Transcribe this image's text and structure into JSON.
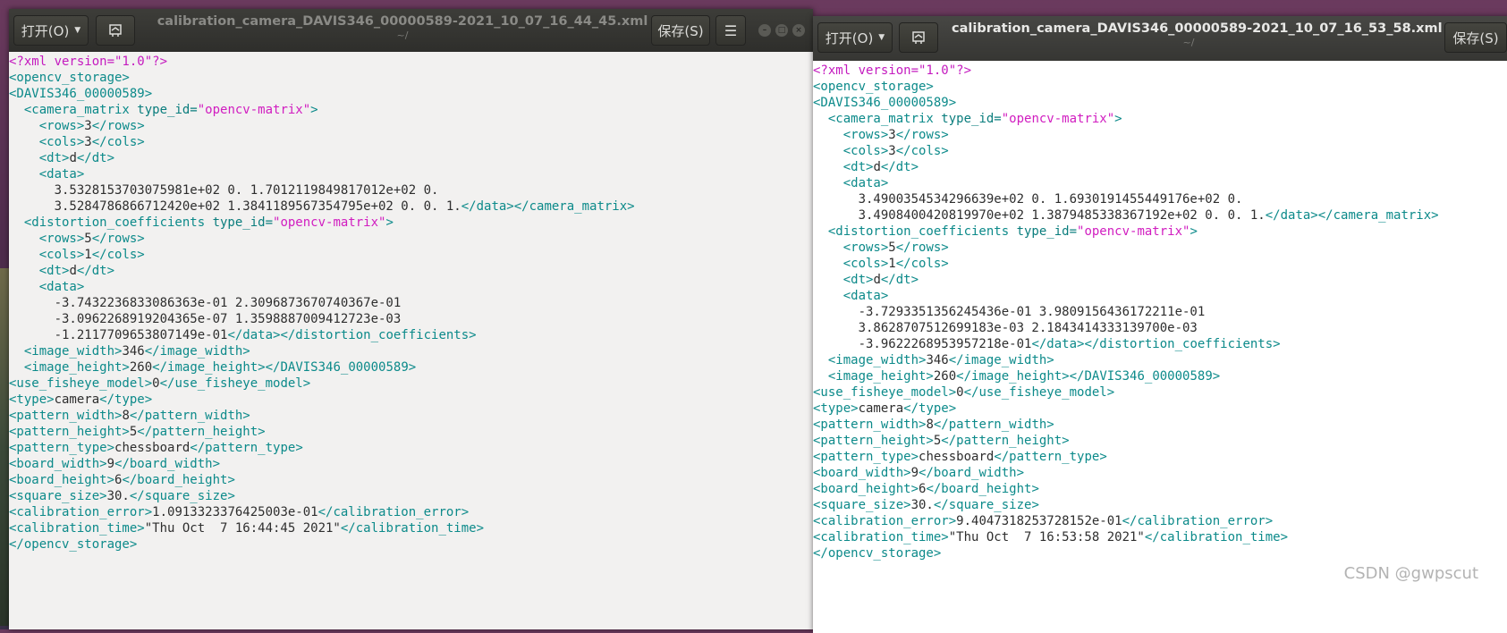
{
  "window1": {
    "title": "calibration_camera_DAVIS346_00000589-2021_10_07_16_44_45.xml",
    "subtitle": "~/",
    "open_label": "打开(O)",
    "save_label": "保存(S)",
    "minimize_symbol": "–",
    "maximize_symbol": "□",
    "close_symbol": "×",
    "menu_icon": "☰",
    "editor_lines": [
      [
        [
          "pi",
          "<?xml version=\"1.0\"?>"
        ]
      ],
      [
        [
          "tag",
          "<opencv_storage>"
        ]
      ],
      [
        [
          "tag",
          "<DAVIS346_00000589>"
        ]
      ],
      [
        [
          "txt",
          "  "
        ],
        [
          "tag",
          "<camera_matrix "
        ],
        [
          "attr",
          "type_id="
        ],
        [
          "str",
          "\"opencv-matrix\""
        ],
        [
          "tag",
          ">"
        ]
      ],
      [
        [
          "txt",
          "    "
        ],
        [
          "tag",
          "<rows>"
        ],
        [
          "txt",
          "3"
        ],
        [
          "tag",
          "</rows>"
        ]
      ],
      [
        [
          "txt",
          "    "
        ],
        [
          "tag",
          "<cols>"
        ],
        [
          "txt",
          "3"
        ],
        [
          "tag",
          "</cols>"
        ]
      ],
      [
        [
          "txt",
          "    "
        ],
        [
          "tag",
          "<dt>"
        ],
        [
          "txt",
          "d"
        ],
        [
          "tag",
          "</dt>"
        ]
      ],
      [
        [
          "txt",
          "    "
        ],
        [
          "tag",
          "<data>"
        ]
      ],
      [
        [
          "txt",
          "      3.5328153703075981e+02 0. 1.7012119849817012e+02 0."
        ]
      ],
      [
        [
          "txt",
          "      3.5284786866712420e+02 1.3841189567354795e+02 0. 0. 1."
        ],
        [
          "tag",
          "</data></camera_matrix>"
        ]
      ],
      [
        [
          "txt",
          "  "
        ],
        [
          "tag",
          "<distortion_coefficients "
        ],
        [
          "attr",
          "type_id="
        ],
        [
          "str",
          "\"opencv-matrix\""
        ],
        [
          "tag",
          ">"
        ]
      ],
      [
        [
          "txt",
          "    "
        ],
        [
          "tag",
          "<rows>"
        ],
        [
          "txt",
          "5"
        ],
        [
          "tag",
          "</rows>"
        ]
      ],
      [
        [
          "txt",
          "    "
        ],
        [
          "tag",
          "<cols>"
        ],
        [
          "txt",
          "1"
        ],
        [
          "tag",
          "</cols>"
        ]
      ],
      [
        [
          "txt",
          "    "
        ],
        [
          "tag",
          "<dt>"
        ],
        [
          "txt",
          "d"
        ],
        [
          "tag",
          "</dt>"
        ]
      ],
      [
        [
          "txt",
          "    "
        ],
        [
          "tag",
          "<data>"
        ]
      ],
      [
        [
          "txt",
          "      -3.7432236833086363e-01 2.3096873670740367e-01"
        ]
      ],
      [
        [
          "txt",
          "      -3.0962268919204365e-07 1.3598887009412723e-03"
        ]
      ],
      [
        [
          "txt",
          "      -1.2117709653807149e-01"
        ],
        [
          "tag",
          "</data></distortion_coefficients>"
        ]
      ],
      [
        [
          "txt",
          "  "
        ],
        [
          "tag",
          "<image_width>"
        ],
        [
          "txt",
          "346"
        ],
        [
          "tag",
          "</image_width>"
        ]
      ],
      [
        [
          "txt",
          "  "
        ],
        [
          "tag",
          "<image_height>"
        ],
        [
          "txt",
          "260"
        ],
        [
          "tag",
          "</image_height></DAVIS346_00000589>"
        ]
      ],
      [
        [
          "tag",
          "<use_fisheye_model>"
        ],
        [
          "txt",
          "0"
        ],
        [
          "tag",
          "</use_fisheye_model>"
        ]
      ],
      [
        [
          "tag",
          "<type>"
        ],
        [
          "txt",
          "camera"
        ],
        [
          "tag",
          "</type>"
        ]
      ],
      [
        [
          "tag",
          "<pattern_width>"
        ],
        [
          "txt",
          "8"
        ],
        [
          "tag",
          "</pattern_width>"
        ]
      ],
      [
        [
          "tag",
          "<pattern_height>"
        ],
        [
          "txt",
          "5"
        ],
        [
          "tag",
          "</pattern_height>"
        ]
      ],
      [
        [
          "tag",
          "<pattern_type>"
        ],
        [
          "txt",
          "chessboard"
        ],
        [
          "tag",
          "</pattern_type>"
        ]
      ],
      [
        [
          "tag",
          "<board_width>"
        ],
        [
          "txt",
          "9"
        ],
        [
          "tag",
          "</board_width>"
        ]
      ],
      [
        [
          "tag",
          "<board_height>"
        ],
        [
          "txt",
          "6"
        ],
        [
          "tag",
          "</board_height>"
        ]
      ],
      [
        [
          "tag",
          "<square_size>"
        ],
        [
          "txt",
          "30."
        ],
        [
          "tag",
          "</square_size>"
        ]
      ],
      [
        [
          "tag",
          "<calibration_error>"
        ],
        [
          "txt",
          "1.0913323376425003e-01"
        ],
        [
          "tag",
          "</calibration_error>"
        ]
      ],
      [
        [
          "tag",
          "<calibration_time>"
        ],
        [
          "txt",
          "\"Thu Oct  7 16:44:45 2021\""
        ],
        [
          "tag",
          "</calibration_time>"
        ]
      ],
      [
        [
          "tag",
          "</opencv_storage>"
        ]
      ]
    ]
  },
  "window2": {
    "title": "calibration_camera_DAVIS346_00000589-2021_10_07_16_53_58.xml",
    "subtitle": "~/",
    "open_label": "打开(O)",
    "save_label": "保存(S)",
    "editor_lines": [
      [
        [
          "pi",
          "<?xml version=\"1.0\"?>"
        ]
      ],
      [
        [
          "tag",
          "<opencv_storage>"
        ]
      ],
      [
        [
          "tag",
          "<DAVIS346_00000589>"
        ]
      ],
      [
        [
          "txt",
          "  "
        ],
        [
          "tag",
          "<camera_matrix "
        ],
        [
          "attr",
          "type_id="
        ],
        [
          "str",
          "\"opencv-matrix\""
        ],
        [
          "tag",
          ">"
        ]
      ],
      [
        [
          "txt",
          "    "
        ],
        [
          "tag",
          "<rows>"
        ],
        [
          "txt",
          "3"
        ],
        [
          "tag",
          "</rows>"
        ]
      ],
      [
        [
          "txt",
          "    "
        ],
        [
          "tag",
          "<cols>"
        ],
        [
          "txt",
          "3"
        ],
        [
          "tag",
          "</cols>"
        ]
      ],
      [
        [
          "txt",
          "    "
        ],
        [
          "tag",
          "<dt>"
        ],
        [
          "txt",
          "d"
        ],
        [
          "tag",
          "</dt>"
        ]
      ],
      [
        [
          "txt",
          "    "
        ],
        [
          "tag",
          "<data>"
        ]
      ],
      [
        [
          "txt",
          "      3.4900354534296639e+02 0. 1.6930191455449176e+02 0."
        ]
      ],
      [
        [
          "txt",
          "      3.4908400420819970e+02 1.3879485338367192e+02 0. 0. 1."
        ],
        [
          "tag",
          "</data></camera_matrix>"
        ]
      ],
      [
        [
          "txt",
          "  "
        ],
        [
          "tag",
          "<distortion_coefficients "
        ],
        [
          "attr",
          "type_id="
        ],
        [
          "str",
          "\"opencv-matrix\""
        ],
        [
          "tag",
          ">"
        ]
      ],
      [
        [
          "txt",
          "    "
        ],
        [
          "tag",
          "<rows>"
        ],
        [
          "txt",
          "5"
        ],
        [
          "tag",
          "</rows>"
        ]
      ],
      [
        [
          "txt",
          "    "
        ],
        [
          "tag",
          "<cols>"
        ],
        [
          "txt",
          "1"
        ],
        [
          "tag",
          "</cols>"
        ]
      ],
      [
        [
          "txt",
          "    "
        ],
        [
          "tag",
          "<dt>"
        ],
        [
          "txt",
          "d"
        ],
        [
          "tag",
          "</dt>"
        ]
      ],
      [
        [
          "txt",
          "    "
        ],
        [
          "tag",
          "<data>"
        ]
      ],
      [
        [
          "txt",
          "      -3.7293351356245436e-01 3.9809156436172211e-01"
        ]
      ],
      [
        [
          "txt",
          "      3.8628707512699183e-03 2.1843414333139700e-03"
        ]
      ],
      [
        [
          "txt",
          "      -3.9622268953957218e-01"
        ],
        [
          "tag",
          "</data></distortion_coefficients>"
        ]
      ],
      [
        [
          "txt",
          "  "
        ],
        [
          "tag",
          "<image_width>"
        ],
        [
          "txt",
          "346"
        ],
        [
          "tag",
          "</image_width>"
        ]
      ],
      [
        [
          "txt",
          "  "
        ],
        [
          "tag",
          "<image_height>"
        ],
        [
          "txt",
          "260"
        ],
        [
          "tag",
          "</image_height></DAVIS346_00000589>"
        ]
      ],
      [
        [
          "tag",
          "<use_fisheye_model>"
        ],
        [
          "txt",
          "0"
        ],
        [
          "tag",
          "</use_fisheye_model>"
        ]
      ],
      [
        [
          "tag",
          "<type>"
        ],
        [
          "txt",
          "camera"
        ],
        [
          "tag",
          "</type>"
        ]
      ],
      [
        [
          "tag",
          "<pattern_width>"
        ],
        [
          "txt",
          "8"
        ],
        [
          "tag",
          "</pattern_width>"
        ]
      ],
      [
        [
          "tag",
          "<pattern_height>"
        ],
        [
          "txt",
          "5"
        ],
        [
          "tag",
          "</pattern_height>"
        ]
      ],
      [
        [
          "tag",
          "<pattern_type>"
        ],
        [
          "txt",
          "chessboard"
        ],
        [
          "tag",
          "</pattern_type>"
        ]
      ],
      [
        [
          "tag",
          "<board_width>"
        ],
        [
          "txt",
          "9"
        ],
        [
          "tag",
          "</board_width>"
        ]
      ],
      [
        [
          "tag",
          "<board_height>"
        ],
        [
          "txt",
          "6"
        ],
        [
          "tag",
          "</board_height>"
        ]
      ],
      [
        [
          "tag",
          "<square_size>"
        ],
        [
          "txt",
          "30."
        ],
        [
          "tag",
          "</square_size>"
        ]
      ],
      [
        [
          "tag",
          "<calibration_error>"
        ],
        [
          "txt",
          "9.4047318253728152e-01"
        ],
        [
          "tag",
          "</calibration_error>"
        ]
      ],
      [
        [
          "tag",
          "<calibration_time>"
        ],
        [
          "txt",
          "\"Thu Oct  7 16:53:58 2021\""
        ],
        [
          "tag",
          "</calibration_time>"
        ]
      ],
      [
        [
          "tag",
          "</opencv_storage>"
        ]
      ]
    ]
  },
  "watermark": "CSDN @gwpscut"
}
